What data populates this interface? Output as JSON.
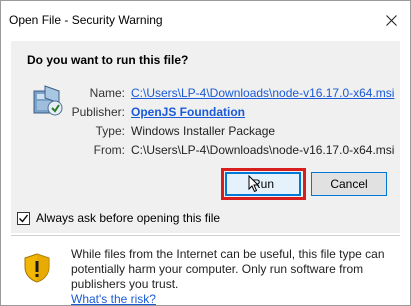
{
  "window": {
    "title": "Open File - Security Warning"
  },
  "main": {
    "question": "Do you want to run this file?",
    "fields": [
      {
        "label": "Name:",
        "value": "C:\\Users\\LP-4\\Downloads\\node-v16.17.0-x64.msi"
      },
      {
        "label": "Publisher:",
        "value": "OpenJS Foundation"
      },
      {
        "label": "Type:",
        "value": "Windows Installer Package"
      },
      {
        "label": "From:",
        "value": "C:\\Users\\LP-4\\Downloads\\node-v16.17.0-x64.msi"
      }
    ],
    "buttons": {
      "run": "Run",
      "cancel": "Cancel"
    },
    "checkbox": {
      "label": "Always ask before opening this file",
      "checked": true
    }
  },
  "footer": {
    "warning_text": "While files from the Internet can be useful, this file type can potentially harm your computer. Only run software from publishers you trust.",
    "warning_link": "What's the risk?"
  },
  "icons": {
    "close": "close-icon",
    "app": "installer-package-icon",
    "warning": "shield-warning-icon",
    "cursor": "mouse-cursor-icon",
    "check": "checkmark-icon"
  },
  "colors": {
    "link": "#1a5ad7",
    "highlight": "#d81d1d",
    "focus": "#0078d7"
  }
}
